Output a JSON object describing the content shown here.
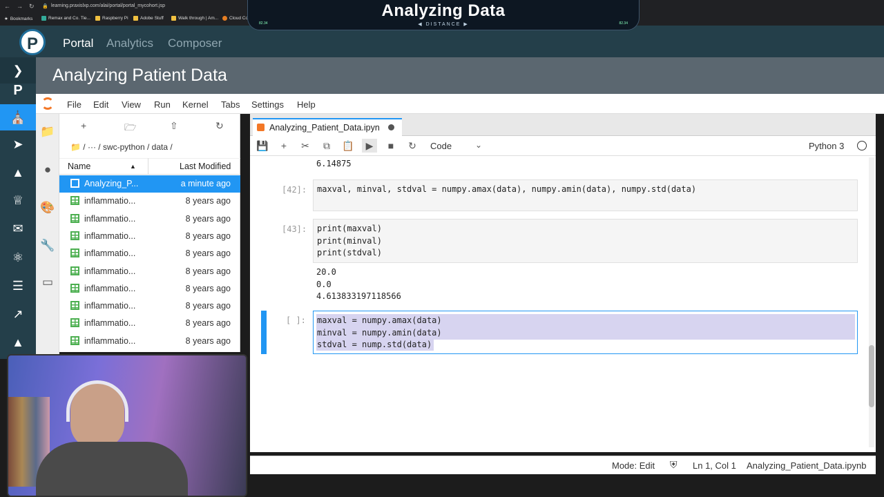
{
  "browser": {
    "url": "learning.praxislxp.com/alai/portal/portal_mycohort.jsp",
    "bookmarks": [
      "Bookmarks",
      "Remax and Co. Tie...",
      "Raspberry Pi",
      "Adobe Stuff",
      "Walk through | Am...",
      "Cloud Co"
    ]
  },
  "overlay": {
    "title": "Analyzing Data",
    "subtitle": "DISTANCE",
    "corner_left": "82.34",
    "corner_right": "82.34"
  },
  "portal": {
    "logo": "P",
    "nav": [
      "Portal",
      "Analytics",
      "Composer"
    ]
  },
  "header": {
    "title": "Analyzing Patient Data"
  },
  "sidebar": {
    "letter": "P",
    "icons": [
      "chevron-right-icon",
      "p-icon",
      "building-icon",
      "rocket-icon",
      "gitlab-icon",
      "trophy-icon",
      "mail-icon",
      "atom-icon",
      "server-icon",
      "chart-icon",
      "graduation-cap-icon"
    ]
  },
  "jupyter": {
    "menu": [
      "File",
      "Edit",
      "View",
      "Run",
      "Kernel",
      "Tabs",
      "Settings",
      "Help"
    ],
    "breadcrumb": "/ ··· / swc-python / data /",
    "columns": {
      "name": "Name",
      "modified": "Last Modified"
    },
    "files": [
      {
        "name": "Analyzing_P...",
        "modified": "a minute ago"
      },
      {
        "name": "inflammatio...",
        "modified": "8 years ago"
      },
      {
        "name": "inflammatio...",
        "modified": "8 years ago"
      },
      {
        "name": "inflammatio...",
        "modified": "8 years ago"
      },
      {
        "name": "inflammatio...",
        "modified": "8 years ago"
      },
      {
        "name": "inflammatio...",
        "modified": "8 years ago"
      },
      {
        "name": "inflammatio...",
        "modified": "8 years ago"
      },
      {
        "name": "inflammatio...",
        "modified": "8 years ago"
      },
      {
        "name": "inflammatio...",
        "modified": "8 years ago"
      },
      {
        "name": "inflammatio...",
        "modified": "8 years ago"
      }
    ],
    "tab": "Analyzing_Patient_Data.ipyn",
    "cell_type": "Code",
    "kernel": "Python 3",
    "output_top": "6.14875",
    "cells": [
      {
        "prompt": "[42]:",
        "code": "maxval, minval, stdval = numpy.amax(data), numpy.amin(data), numpy.std(data)"
      },
      {
        "prompt": "[43]:",
        "code": "print(maxval)\nprint(minval)\nprint(stdval)",
        "output": "20.0\n0.0\n4.613833197118566"
      },
      {
        "prompt": "[ ]:",
        "code": "maxval = numpy.amax(data)\nminval = numpy.amin(data)\nstdval = nump.std(data)"
      }
    ],
    "status": {
      "mode": "Mode: Edit",
      "position": "Ln 1, Col 1",
      "file": "Analyzing_Patient_Data.ipynb"
    }
  },
  "colors": {
    "portal": "#243f4a",
    "header": "#5b6770",
    "accent": "#2196f3",
    "jupyter_orange": "#f37726"
  }
}
